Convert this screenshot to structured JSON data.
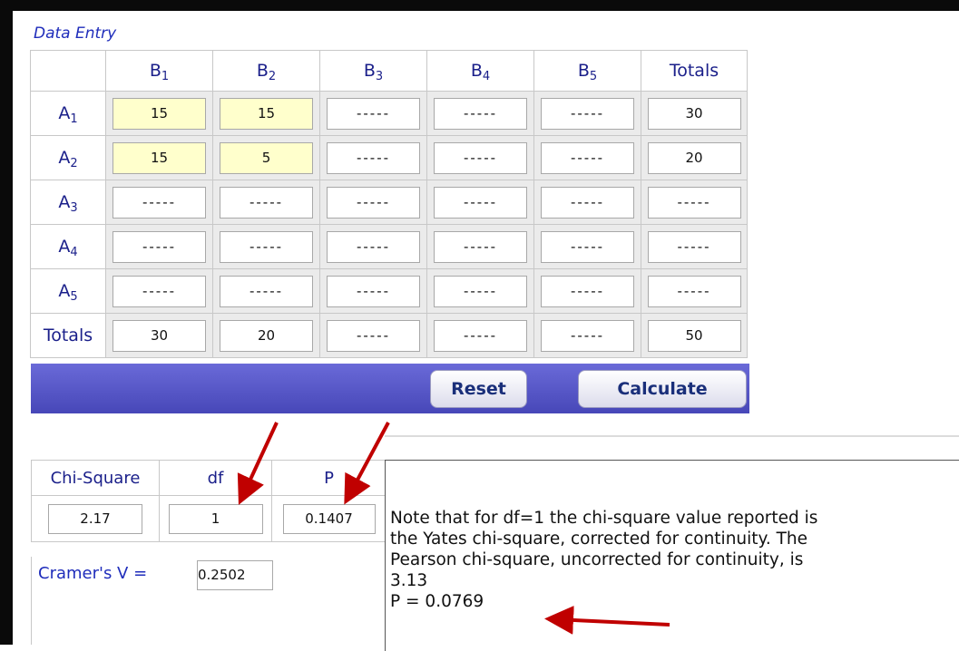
{
  "section_title": "Data Entry",
  "columns": [
    {
      "main": "B",
      "sub": "1"
    },
    {
      "main": "B",
      "sub": "2"
    },
    {
      "main": "B",
      "sub": "3"
    },
    {
      "main": "B",
      "sub": "4"
    },
    {
      "main": "B",
      "sub": "5"
    }
  ],
  "totals_label": "Totals",
  "rows": [
    {
      "main": "A",
      "sub": "1",
      "cells": [
        "15",
        "15",
        "-----",
        "-----",
        "-----"
      ],
      "total": "30"
    },
    {
      "main": "A",
      "sub": "2",
      "cells": [
        "15",
        "5",
        "-----",
        "-----",
        "-----"
      ],
      "total": "20"
    },
    {
      "main": "A",
      "sub": "3",
      "cells": [
        "-----",
        "-----",
        "-----",
        "-----",
        "-----"
      ],
      "total": "-----"
    },
    {
      "main": "A",
      "sub": "4",
      "cells": [
        "-----",
        "-----",
        "-----",
        "-----",
        "-----"
      ],
      "total": "-----"
    },
    {
      "main": "A",
      "sub": "5",
      "cells": [
        "-----",
        "-----",
        "-----",
        "-----",
        "-----"
      ],
      "total": "-----"
    }
  ],
  "column_totals": [
    "30",
    "20",
    "-----",
    "-----",
    "-----"
  ],
  "grand_total": "50",
  "buttons": {
    "reset": "Reset",
    "calculate": "Calculate"
  },
  "results": {
    "chi_square_label": "Chi-Square",
    "df_label": "df",
    "p_label": "P",
    "chi_square": "2.17",
    "df": "1",
    "p": "0.1407",
    "cramers_v_label": "Cramer's V =",
    "cramers_v": "0.2502"
  },
  "note": {
    "line1": "Note that for df=1 the chi-square value reported is",
    "line2": "the Yates chi-square, corrected for continuity. The",
    "line3": "Pearson chi-square, uncorrected for continuity, is",
    "line4": "3.13",
    "line5": "P = 0.0769"
  },
  "colors": {
    "entered_cell": "#ffffcc",
    "button_bar": "#5555c8",
    "annotation_arrow": "#c00000"
  }
}
